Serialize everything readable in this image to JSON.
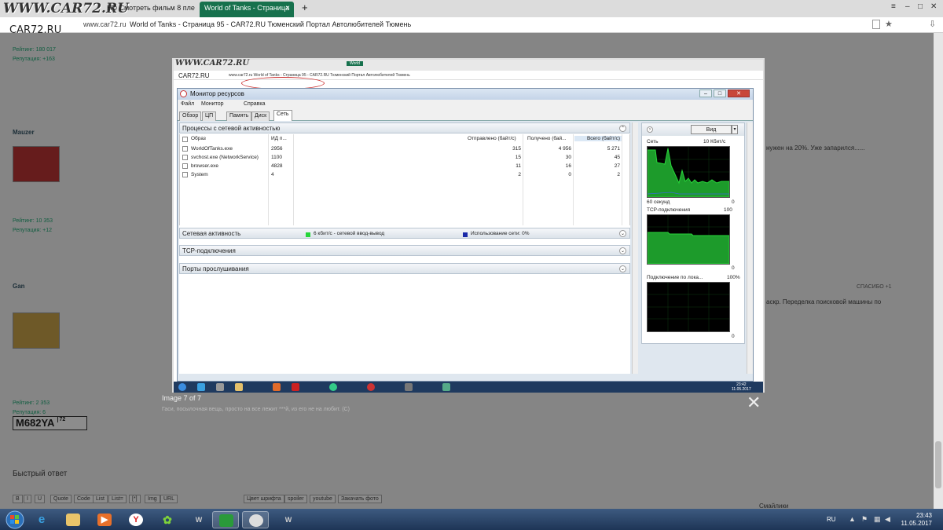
{
  "browser": {
    "watermark": "WWW.CAR72.RU",
    "watermark_small": "CAR72.RU",
    "tabs": [
      {
        "label": "HD Смотреть фильм 8 плену у",
        "active": false
      },
      {
        "label": "World of Tanks - Страница",
        "active": true
      }
    ],
    "tab_close": "×",
    "new_tab": "+",
    "url_host": "www.car72.ru",
    "page_title": "World of Tanks - Страница 95 - CAR72.RU Тюменский Портал Автолюбителей Тюмень",
    "window_controls": [
      "≡",
      "–",
      "□",
      "✕"
    ]
  },
  "forum": {
    "users": [
      {
        "name": "Mauzer",
        "rating_label": "Рейтинг: 10 353",
        "reputation": "Репутация: +12"
      },
      {
        "name": "Gan",
        "rating_label": "Рейтинг: 2 353",
        "reputation": "Репутация: 6"
      }
    ],
    "top_rating": "Рейтинг: 180 017",
    "top_reputation": "Репутация: +163",
    "plate_number": "M682YA",
    "plate_region": "72",
    "quick_reply": "Быстрый ответ",
    "editor_buttons": [
      "B",
      "I",
      "U",
      "Quote",
      "Code",
      "List",
      "List=",
      "[*]",
      "Img",
      "URL"
    ],
    "editor_buttons_right": [
      "Цвет шрифта",
      "spoiler",
      "youtube",
      "Закачать фото"
    ],
    "smilies_label": "Смайлики",
    "right_text_1": "нужен на 20%. Уже запарился......",
    "right_text_2": "аскр. Переделка поисковой машины по",
    "post_action": "СПАСИБО +1"
  },
  "lightbox": {
    "caption": "Image 7 of 7",
    "description": "Гаси, посылочная вещь, просто на все лежит ***й, из его не на любит. (С)",
    "close_symbol": "✕",
    "inner_url": "www.car72.ru World of Tanks - Страница 95 - CAR72.RU Тюменский Портал Автолюбителей Тюмень",
    "inner_clock_time": "23:42",
    "inner_clock_date": "11.05.2017"
  },
  "resmon": {
    "title": "Монитор ресурсов",
    "menu": [
      "Файл",
      "Монитор",
      "Справка"
    ],
    "tabs": [
      "Обзор",
      "ЦП",
      "Память",
      "Диск",
      "Сеть"
    ],
    "active_tab": "Сеть",
    "sections": {
      "processes": "Процессы с сетевой активностью",
      "network": "Сетевая активность",
      "tcp": "TCP-подключения",
      "ports": "Порты прослушивания"
    },
    "network_legend_1": "6 кбит/с - сетевой ввод-вывод",
    "network_legend_2": "Использование сети: 0%",
    "columns": [
      "Образ",
      "ИД п...",
      "Отправлено (байт/с)",
      "Получено (бай...",
      "Всего (байт/с)"
    ],
    "rows": [
      {
        "image": "WorldOfTanks.exe",
        "pid": "2956",
        "sent": "315",
        "recv": "4 956",
        "total": "5 271"
      },
      {
        "image": "svchost.exe (NetworkService)",
        "pid": "1100",
        "sent": "15",
        "recv": "30",
        "total": "45"
      },
      {
        "image": "browser.exe",
        "pid": "4828",
        "sent": "11",
        "recv": "16",
        "total": "27"
      },
      {
        "image": "System",
        "pid": "4",
        "sent": "2",
        "recv": "0",
        "total": "2"
      }
    ],
    "right_panel": {
      "view_button": "Вид",
      "graphs": [
        {
          "title": "Сеть",
          "max": "10 Кбит/с",
          "left_bottom": "60 секунд",
          "min": "0"
        },
        {
          "title": "TCP-подключения",
          "max": "100",
          "left_bottom": "",
          "min": "0"
        },
        {
          "title": "Подключение по лока...",
          "max": "100%",
          "left_bottom": "",
          "min": "0"
        }
      ]
    }
  },
  "taskbar": {
    "lang": "RU",
    "time": "23:43",
    "date": "11.05.2017"
  },
  "colors": {
    "tab_active": "#17714d",
    "graph_green": "#27d63a",
    "taskbar": "#1e3556"
  }
}
